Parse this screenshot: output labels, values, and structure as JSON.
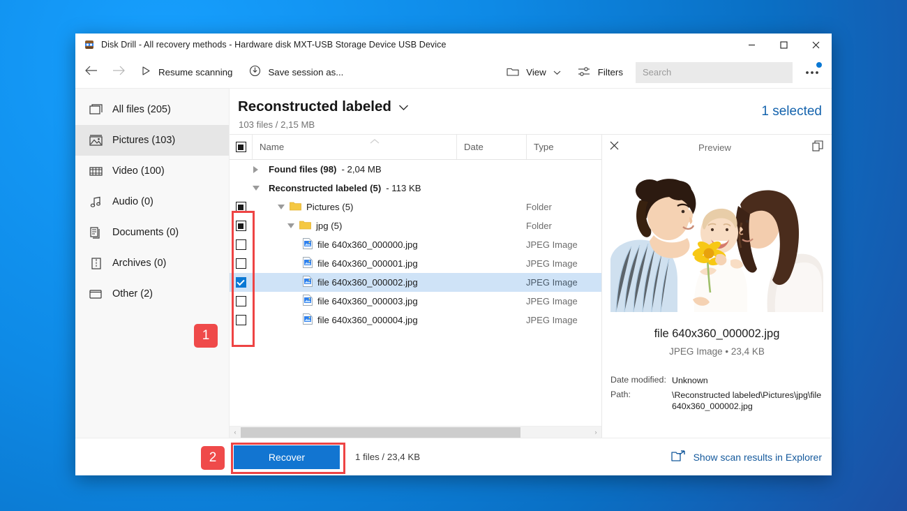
{
  "window": {
    "title": "Disk Drill - All recovery methods - Hardware disk MXT-USB Storage Device USB Device",
    "app_icon": "disk-drill-icon",
    "controls": {
      "minimize": "–",
      "maximize": "□",
      "close": "✕"
    }
  },
  "toolbar": {
    "back_icon": "back-arrow-icon",
    "forward_icon": "forward-arrow-icon",
    "resume_label": "Resume scanning",
    "resume_icon": "play-icon",
    "save_label": "Save session as...",
    "save_icon": "download-circle-icon",
    "view_label": "View",
    "view_icon": "folder-icon",
    "filters_label": "Filters",
    "filters_icon": "sliders-icon",
    "search_placeholder": "Search",
    "search_value": "",
    "more_icon": "ellipsis-icon",
    "more_badge_color": "#0a78d4"
  },
  "sidebar": {
    "items": [
      {
        "label": "All files (205)",
        "icon": "files-icon",
        "active": false
      },
      {
        "label": "Pictures (103)",
        "icon": "picture-icon",
        "active": true
      },
      {
        "label": "Video (100)",
        "icon": "film-icon",
        "active": false
      },
      {
        "label": "Audio (0)",
        "icon": "music-note-icon",
        "active": false
      },
      {
        "label": "Documents (0)",
        "icon": "documents-icon",
        "active": false
      },
      {
        "label": "Archives (0)",
        "icon": "archive-icon",
        "active": false
      },
      {
        "label": "Other (2)",
        "icon": "folder-other-icon",
        "active": false
      }
    ]
  },
  "main": {
    "title": "Reconstructed labeled",
    "title_chevron": "chevron-down-icon",
    "subtitle": "103 files / 2,15 MB",
    "selected_badge": "1 selected",
    "selected_badge_color": "#1463ad"
  },
  "table": {
    "columns": {
      "name": "Name",
      "date": "Date",
      "type": "Type"
    },
    "header_checkbox_state": "partial",
    "sort_indicator": "sort-ascending-caret",
    "rows": [
      {
        "kind": "group",
        "name": "Found files (98)",
        "size": "- 2,04 MB",
        "expanded": false,
        "checkbox": "none",
        "indent": 0,
        "date": "",
        "type": ""
      },
      {
        "kind": "group",
        "name": "Reconstructed labeled (5)",
        "size": "- 113 KB",
        "expanded": true,
        "checkbox": "none",
        "indent": 0,
        "date": "",
        "type": ""
      },
      {
        "kind": "folder",
        "name": "Pictures (5)",
        "size": "",
        "expanded": true,
        "checkbox": "partial",
        "indent": 1,
        "date": "",
        "type": "Folder"
      },
      {
        "kind": "folder",
        "name": "jpg (5)",
        "size": "",
        "expanded": true,
        "checkbox": "partial",
        "indent": 2,
        "date": "",
        "type": "Folder"
      },
      {
        "kind": "file",
        "name": "file 640x360_000000.jpg",
        "size": "",
        "expanded": false,
        "checkbox": "unchecked",
        "indent": 3,
        "date": "",
        "type": "JPEG Image",
        "selected": false
      },
      {
        "kind": "file",
        "name": "file 640x360_000001.jpg",
        "size": "",
        "expanded": false,
        "checkbox": "unchecked",
        "indent": 3,
        "date": "",
        "type": "JPEG Image",
        "selected": false
      },
      {
        "kind": "file",
        "name": "file 640x360_000002.jpg",
        "size": "",
        "expanded": false,
        "checkbox": "checked",
        "indent": 3,
        "date": "",
        "type": "JPEG Image",
        "selected": true
      },
      {
        "kind": "file",
        "name": "file 640x360_000003.jpg",
        "size": "",
        "expanded": false,
        "checkbox": "unchecked",
        "indent": 3,
        "date": "",
        "type": "JPEG Image",
        "selected": false
      },
      {
        "kind": "file",
        "name": "file 640x360_000004.jpg",
        "size": "",
        "expanded": false,
        "checkbox": "unchecked",
        "indent": 3,
        "date": "",
        "type": "JPEG Image",
        "selected": false
      }
    ],
    "scrollbar": {
      "left_arrow": "‹",
      "right_arrow": "›",
      "thumb_percent": 80
    }
  },
  "preview": {
    "close_icon": "close-icon",
    "title": "Preview",
    "popout_icon": "popout-icon",
    "image_alt": "family-photo-man-baby-woman-yellow-flower",
    "file_name": "file 640x360_000002.jpg",
    "file_meta": "JPEG Image • 23,4 KB",
    "details": [
      {
        "label": "Date modified:",
        "value": "Unknown"
      },
      {
        "label": "Path:",
        "value": "\\Reconstructed labeled\\Pictures\\jpg\\file 640x360_000002.jpg"
      }
    ]
  },
  "footer": {
    "recover_label": "Recover",
    "recover_color": "#1275d1",
    "count_label": "1 files / 23,4 KB",
    "explorer_label": "Show scan results in Explorer",
    "explorer_icon": "folder-open-arrow-icon",
    "explorer_color": "#14599c"
  },
  "annotations": [
    {
      "badge": "1",
      "color": "#ef4a4a"
    },
    {
      "badge": "2",
      "color": "#ef4a4a"
    }
  ]
}
